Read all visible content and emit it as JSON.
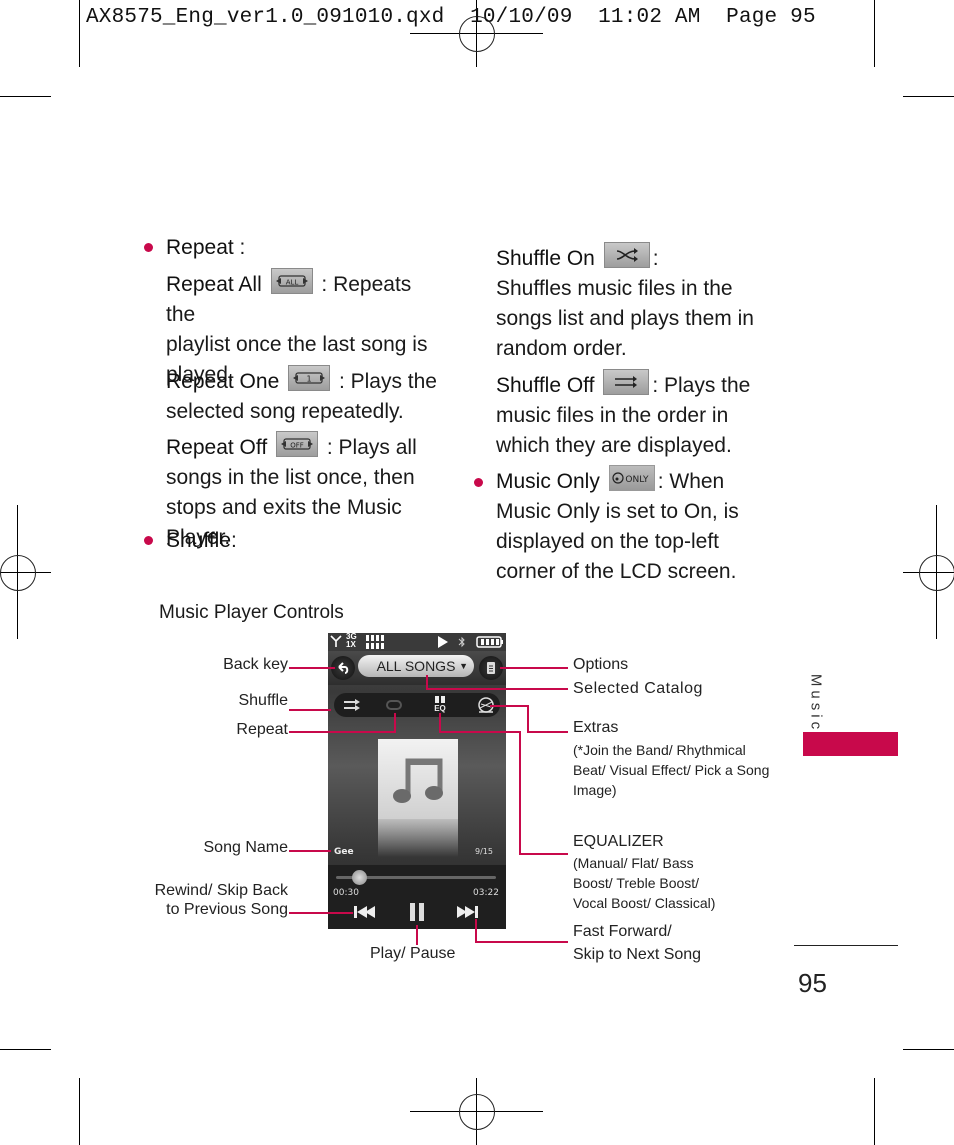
{
  "slug": {
    "filename": "AX8575_Eng_ver1.0_091010.qxd",
    "date": "10/10/09",
    "time": "11:02 AM",
    "page_label": "Page 95"
  },
  "left_column": {
    "repeat_heading": "Repeat",
    "repeat_colon": " :",
    "repeat_all": {
      "term": "Repeat All",
      "icon_text": "ALL",
      "line1": ": Repeats the",
      "line2": "playlist once the last song is",
      "line3": "played."
    },
    "repeat_one": {
      "term": "Repeat One",
      "icon_text": "1",
      "line1": ": Plays the",
      "line2": "selected song repeatedly."
    },
    "repeat_off": {
      "term": "Repeat Off",
      "icon_text": "OFF",
      "line1": ": Plays all",
      "line2": "songs in the list once, then",
      "line3": "stops and exits the Music Player."
    },
    "shuffle_heading": "Shuffle",
    "shuffle_colon": ":"
  },
  "right_column": {
    "shuffle_on": {
      "term": "Shuffle On",
      "colon": ":",
      "line1": "Shuffles music files in the",
      "line2": "songs list and plays them in",
      "line3": "random order."
    },
    "shuffle_off": {
      "term": "Shuffle Off",
      "line1": ": Plays the",
      "line2": "music files in the order in",
      "line3": "which they are displayed."
    },
    "music_only": {
      "term": "Music Only",
      "icon_text": "ONLY",
      "line1": ": When",
      "line2": "Music Only is set to On, is",
      "line3": "displayed on the top-left",
      "line4": "corner of the LCD screen."
    }
  },
  "diagram": {
    "title": "Music Player Controls",
    "labels": {
      "back_key": "Back key",
      "shuffle": "Shuffle",
      "repeat": "Repeat",
      "song_name": "Song Name",
      "rewind_line1": "Rewind/ Skip Back",
      "rewind_line2": "to Previous Song",
      "play_pause": "Play/ Pause",
      "options": "Options",
      "selected_catalog": "Selected Catalog",
      "extras": "Extras",
      "extras_detail_1": "(*Join the Band/ Rhythmical",
      "extras_detail_2": "Beat/ Visual Effect/ Pick a Song",
      "extras_detail_3": "Image)",
      "equalizer": "EQUALIZER",
      "eq_detail_1": "(Manual/ Flat/ Bass",
      "eq_detail_2": "Boost/ Treble Boost/",
      "eq_detail_3": "Vocal Boost/ Classical)",
      "ff_line1": "Fast Forward/",
      "ff_line2": "Skip to Next Song"
    },
    "phone_screen": {
      "network_top": "3G",
      "network_bottom": "1X",
      "catalog": "ALL SONGS",
      "eq_text": "EQ",
      "song": "Gee",
      "track_position": "9/15",
      "elapsed": "00:30",
      "duration": "03:22",
      "progress_fraction": 0.149
    }
  },
  "side_tab": {
    "label": "Music"
  },
  "page_number": "95",
  "colors": {
    "accent": "#c8094b"
  }
}
